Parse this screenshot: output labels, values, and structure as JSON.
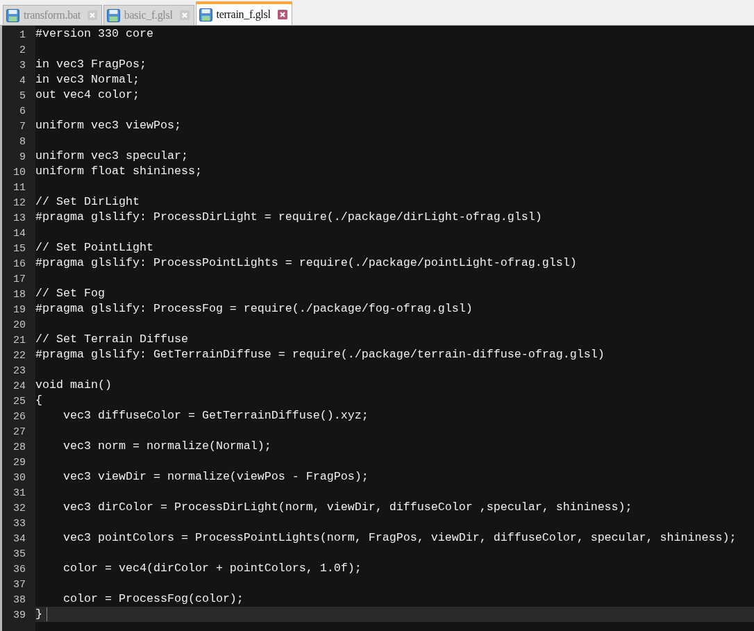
{
  "tabs": [
    {
      "label": "transform.bat",
      "selected": false
    },
    {
      "label": "basic_f.glsl",
      "selected": false
    },
    {
      "label": "terrain_f.glsl",
      "selected": true
    }
  ],
  "editor": {
    "lines": [
      {
        "number": "1",
        "text": "#version 330 core",
        "current": false
      },
      {
        "number": "2",
        "current": false
      },
      {
        "number": "3",
        "text": "in vec3 FragPos;",
        "current": false
      },
      {
        "number": "4",
        "text": "in vec3 Normal;",
        "current": false
      },
      {
        "number": "5",
        "text": "out vec4 color;",
        "current": false
      },
      {
        "number": "6",
        "current": false
      },
      {
        "number": "7",
        "text": "uniform vec3 viewPos;",
        "current": false
      },
      {
        "number": "8",
        "current": false
      },
      {
        "number": "9",
        "text": "uniform vec3 specular;",
        "current": false
      },
      {
        "number": "10",
        "text": "uniform float shininess;",
        "current": false
      },
      {
        "number": "11",
        "current": false
      },
      {
        "number": "12",
        "text": "// Set DirLight",
        "current": false
      },
      {
        "number": "13",
        "text": "#pragma glslify: ProcessDirLight = require(./package/dirLight-ofrag.glsl)",
        "current": false
      },
      {
        "number": "14",
        "current": false
      },
      {
        "number": "15",
        "text": "// Set PointLight",
        "current": false
      },
      {
        "number": "16",
        "text": "#pragma glslify: ProcessPointLights = require(./package/pointLight-ofrag.glsl)",
        "current": false
      },
      {
        "number": "17",
        "current": false
      },
      {
        "number": "18",
        "text": "// Set Fog",
        "current": false
      },
      {
        "number": "19",
        "text": "#pragma glslify: ProcessFog = require(./package/fog-ofrag.glsl)",
        "current": false
      },
      {
        "number": "20",
        "current": false
      },
      {
        "number": "21",
        "text": "// Set Terrain Diffuse",
        "current": false
      },
      {
        "number": "22",
        "text": "#pragma glslify: GetTerrainDiffuse = require(./package/terrain-diffuse-ofrag.glsl)",
        "current": false
      },
      {
        "number": "23",
        "current": false
      },
      {
        "number": "24",
        "text": "void main()",
        "current": false
      },
      {
        "number": "25",
        "text": "{",
        "current": false
      },
      {
        "number": "26",
        "text": "    vec3 diffuseColor = GetTerrainDiffuse().xyz;",
        "current": false
      },
      {
        "number": "27",
        "current": false
      },
      {
        "number": "28",
        "text": "    vec3 norm = normalize(Normal);",
        "current": false
      },
      {
        "number": "29",
        "current": false
      },
      {
        "number": "30",
        "text": "    vec3 viewDir = normalize(viewPos - FragPos);",
        "current": false
      },
      {
        "number": "31",
        "current": false
      },
      {
        "number": "32",
        "text": "    vec3 dirColor = ProcessDirLight(norm, viewDir, diffuseColor ,specular, shininess);",
        "current": false
      },
      {
        "number": "33",
        "current": false
      },
      {
        "number": "34",
        "text": "    vec3 pointColors = ProcessPointLights(norm, FragPos, viewDir, diffuseColor, specular, shininess);",
        "current": false
      },
      {
        "number": "35",
        "current": false
      },
      {
        "number": "36",
        "text": "    color = vec4(dirColor + pointColors, 1.0f);",
        "current": false
      },
      {
        "number": "37",
        "current": false
      },
      {
        "number": "38",
        "text": "    color = ProcessFog(color);",
        "current": false
      },
      {
        "number": "39",
        "text": "}",
        "current": true
      }
    ]
  }
}
